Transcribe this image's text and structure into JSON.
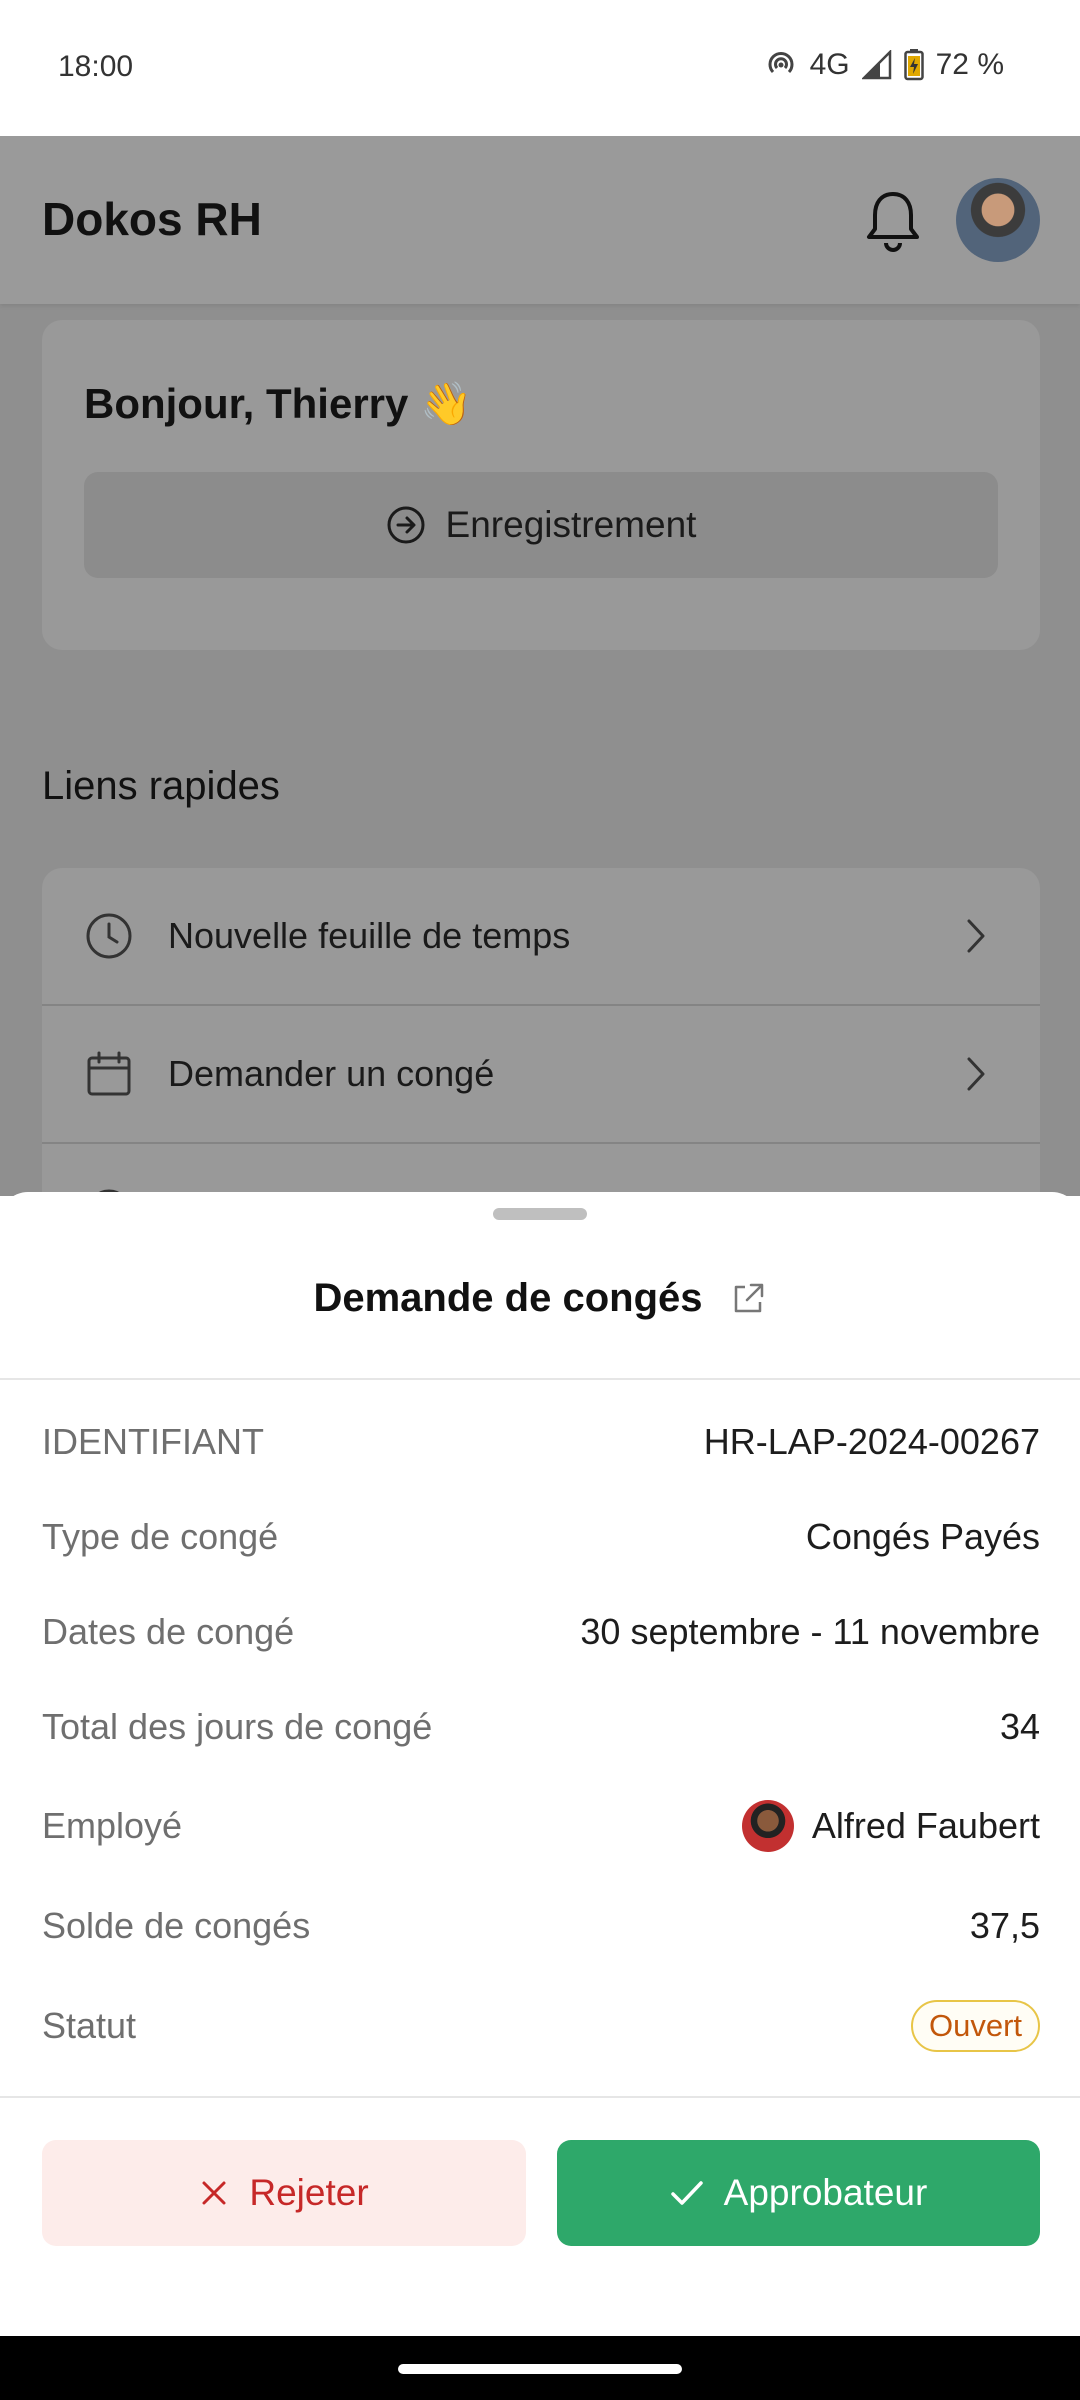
{
  "status_bar": {
    "time": "18:00",
    "network": "4G",
    "battery": "72 %"
  },
  "app": {
    "title": "Dokos RH",
    "greeting": "Bonjour, Thierry 👋",
    "checkin_label": "Enregistrement",
    "quick_links_title": "Liens rapides",
    "quick_links": [
      {
        "label": "Nouvelle feuille de temps",
        "icon": "clock-icon"
      },
      {
        "label": "Demander un congé",
        "icon": "calendar-icon"
      }
    ]
  },
  "sheet": {
    "title": "Demande de congés",
    "fields": {
      "id": {
        "label": "IDENTIFIANT",
        "value": "HR-LAP-2024-00267"
      },
      "leave_type": {
        "label": "Type de congé",
        "value": "Congés Payés"
      },
      "dates": {
        "label": "Dates de congé",
        "value": "30 septembre - 11 novembre"
      },
      "total_days": {
        "label": "Total des jours de congé",
        "value": "34"
      },
      "employee": {
        "label": "Employé",
        "value": "Alfred Faubert"
      },
      "balance": {
        "label": "Solde de congés",
        "value": "37,5"
      },
      "status": {
        "label": "Statut",
        "value": "Ouvert"
      }
    },
    "reject_label": "Rejeter",
    "approve_label": "Approbateur"
  },
  "colors": {
    "approve": "#2ea86a",
    "reject_text": "#c62828",
    "reject_bg": "#fdecea",
    "status_badge_border": "#e8c547",
    "status_badge_text": "#c2570b"
  }
}
